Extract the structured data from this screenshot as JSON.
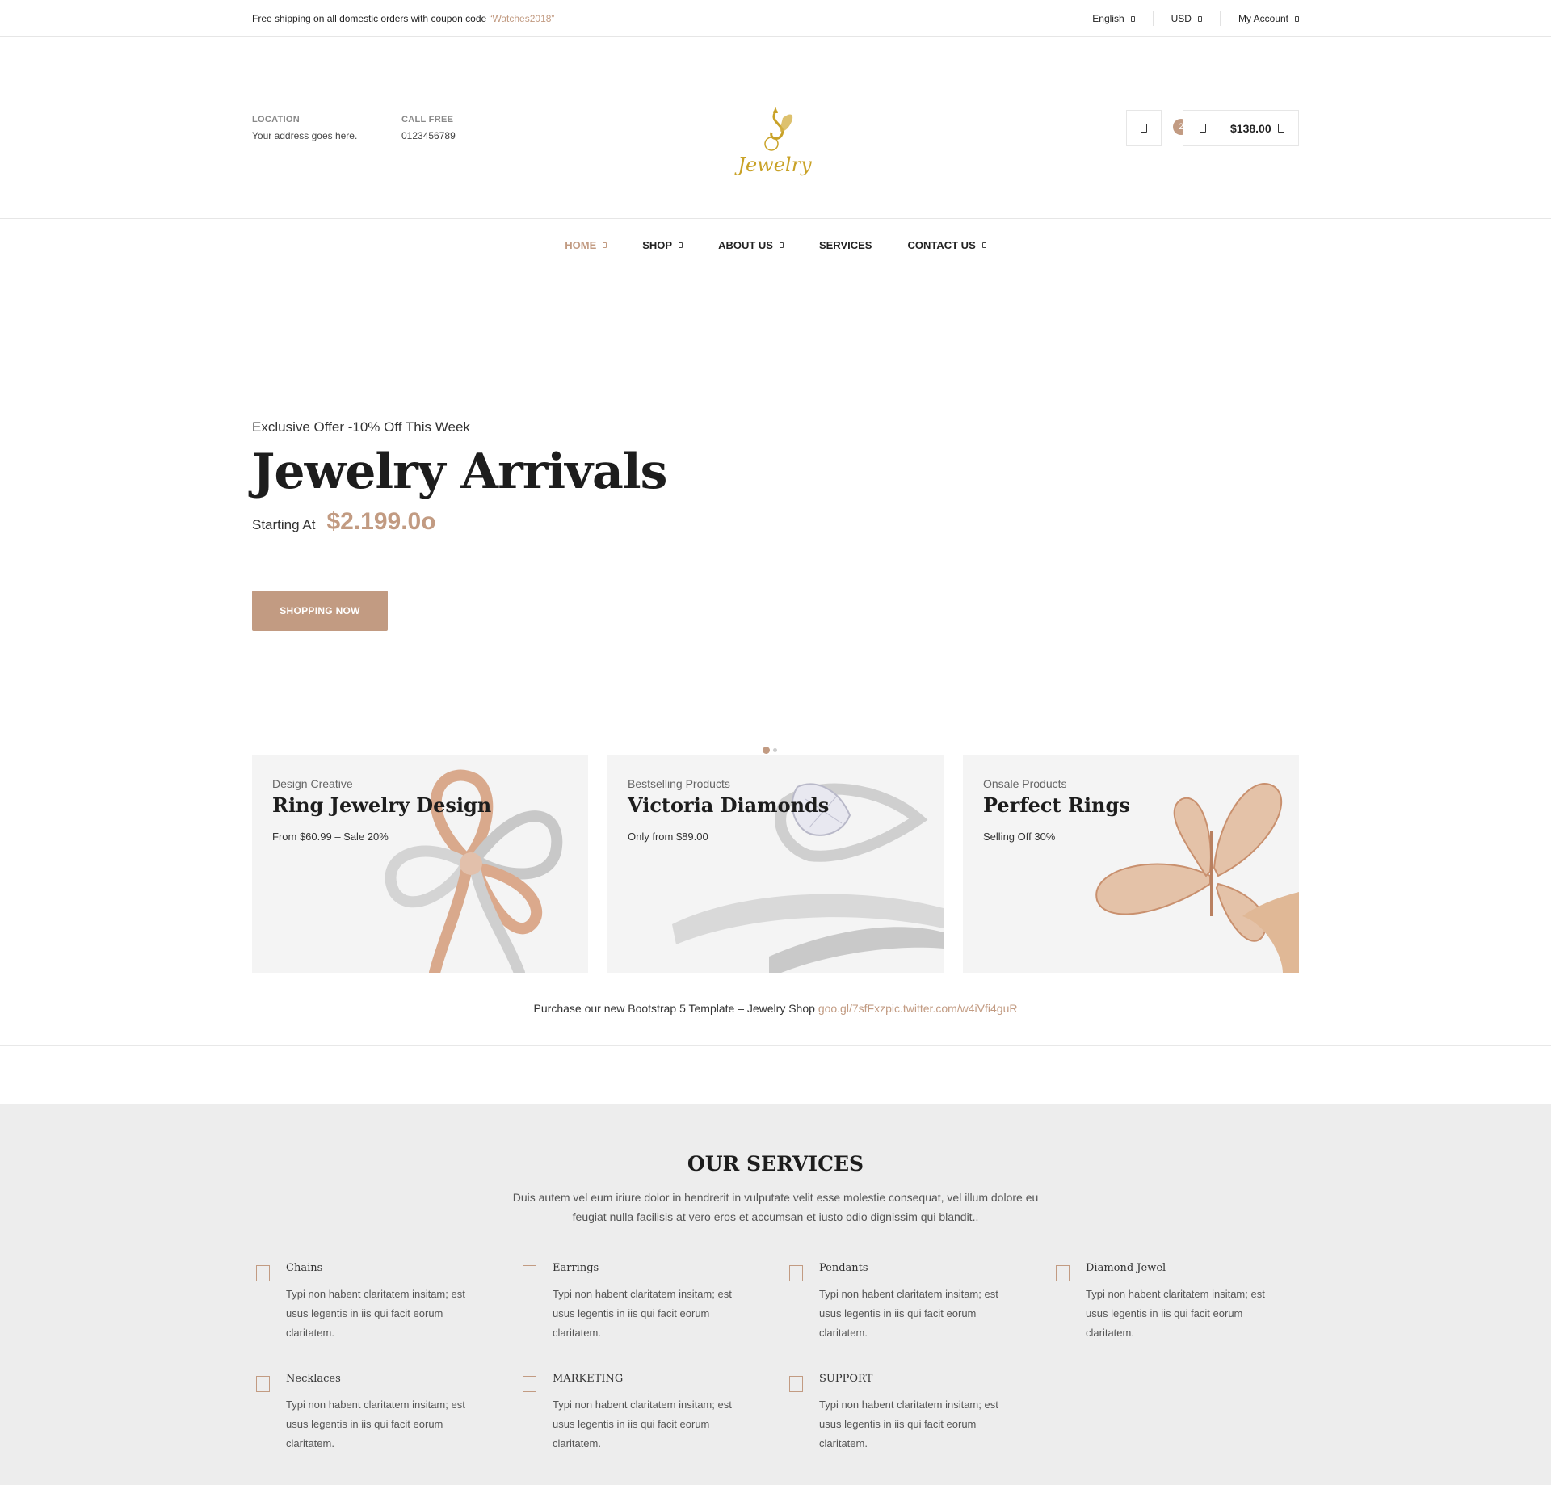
{
  "topbar": {
    "promo_text": "Free shipping on all domestic orders with coupon code ",
    "promo_code": "“Watches2018”",
    "language": "English",
    "currency": "USD",
    "account": "My Account"
  },
  "header": {
    "location_label": "LOCATION",
    "location_value": "Your address goes here.",
    "call_label": "CALL FREE",
    "call_value": "0123456789",
    "logo_text": "Jewelry",
    "cart_count": "2",
    "cart_total": "$138.00"
  },
  "nav": {
    "items": [
      {
        "label": "HOME"
      },
      {
        "label": "SHOP"
      },
      {
        "label": "ABOUT US"
      },
      {
        "label": "SERVICES"
      },
      {
        "label": "CONTACT US"
      }
    ]
  },
  "hero": {
    "offer": "Exclusive Offer -10% Off This Week",
    "title": "Jewelry Arrivals",
    "starting_label": "Starting At",
    "price": "$2.199.0o",
    "cta": "SHOPPING NOW"
  },
  "banners": [
    {
      "subtitle": "Design Creative",
      "title": "Ring Jewelry Design",
      "desc": "From $60.99 – Sale 20%"
    },
    {
      "subtitle": "Bestselling Products",
      "title": "Victoria Diamonds",
      "desc": "Only from $89.00"
    },
    {
      "subtitle": "Onsale Products",
      "title": "Perfect Rings",
      "desc": "Selling Off 30%"
    }
  ],
  "purchase": {
    "text": "Purchase our new Bootstrap 5 Template – Jewelry Shop ",
    "link": "goo.gl/7sfFxzpic.twitter.com/w4iVfi4guR"
  },
  "services": {
    "title": "OUR SERVICES",
    "description": "Duis autem vel eum iriure dolor in hendrerit in vulputate velit esse molestie consequat, vel illum dolore eu feugiat nulla facilisis at vero eros et accumsan et iusto odio dignissim qui blandit..",
    "items": [
      {
        "name": "Chains",
        "text": "Typi non habent claritatem insitam; est usus legentis in iis qui facit eorum claritatem."
      },
      {
        "name": "Earrings",
        "text": "Typi non habent claritatem insitam; est usus legentis in iis qui facit eorum claritatem."
      },
      {
        "name": "Pendants",
        "text": "Typi non habent claritatem insitam; est usus legentis in iis qui facit eorum claritatem."
      },
      {
        "name": "Diamond Jewel",
        "text": "Typi non habent claritatem insitam; est usus legentis in iis qui facit eorum claritatem."
      },
      {
        "name": "Necklaces",
        "text": "Typi non habent claritatem insitam; est usus legentis in iis qui facit eorum claritatem."
      },
      {
        "name": "MARKETING",
        "text": "Typi non habent claritatem insitam; est usus legentis in iis qui facit eorum claritatem."
      },
      {
        "name": "SUPPORT",
        "text": "Typi non habent claritatem insitam; est usus legentis in iis qui facit eorum claritatem."
      }
    ]
  },
  "colors": {
    "accent": "#c29b82",
    "services_bg": "#ededed",
    "banner_bg": "#f4f4f4"
  }
}
